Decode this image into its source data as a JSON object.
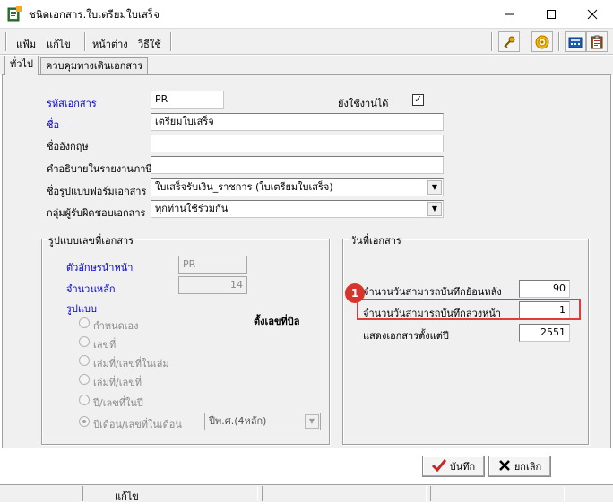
{
  "window": {
    "title": "ชนิดเอกสาร.ใบเตรียมใบเสร็จ",
    "icon": "app-document-icon",
    "controls": [
      "minimize",
      "maximize",
      "close"
    ]
  },
  "menu": {
    "items": [
      "แฟ้ม",
      "แก้ไข",
      "หน้าต่าง",
      "วิธีใช้"
    ],
    "toolbar_icons": [
      "key-icon",
      "target-icon",
      "calculator-icon",
      "clipboard-icon"
    ]
  },
  "tabs": [
    {
      "label": "ทั่วไป",
      "active": true
    },
    {
      "label": "ควบคุมทางเดินเอกสาร",
      "active": false
    }
  ],
  "form": {
    "doc_code": {
      "label": "รหัสเอกสาร",
      "value": "PR"
    },
    "active_label": "ยังใช้งานได้",
    "active_checked": "✓",
    "name": {
      "label": "ชื่อ",
      "value": "เตรียมใบเสร็จ"
    },
    "name_en": {
      "label": "ชื่ออังกฤษ",
      "value": ""
    },
    "tax_report_desc": {
      "label": "คำอธิบายในรายงานภาษี",
      "value": ""
    },
    "form_name": {
      "label": "ชื่อรูปแบบฟอร์มเอกสาร",
      "value": "ใบเสร็จรับเงิน_ราชการ (ใบเตรียมใบเสร็จ)"
    },
    "responsible_group": {
      "label": "กลุ่มผู้รับผิดชอบเอกสาร",
      "value": "ทุกท่านใช้ร่วมกัน"
    }
  },
  "numbering": {
    "title": "รูปแบบเลขที่เอกสาร",
    "prefix": {
      "label": "ตัวอักษรนำหน้า",
      "value": "PR"
    },
    "digits": {
      "label": "จำนวนหลัก",
      "value": "14"
    },
    "format_label": "รูปแบบ",
    "set_number_link": "ตั้งเลขที่บิล",
    "options": [
      {
        "label": "กำหนดเอง",
        "selected": false
      },
      {
        "label": "เลขที่",
        "selected": false
      },
      {
        "label": "เล่มที่/เลขที่ในเล่ม",
        "selected": false
      },
      {
        "label": "เล่มที่/เลขที่",
        "selected": false
      },
      {
        "label": "ปี/เลขที่ในปี",
        "selected": false
      },
      {
        "label": "ปีเดือน/เลขที่ในเดือน",
        "selected": true
      }
    ],
    "year_format": "ปีพ.ศ.(4หลัก)"
  },
  "doc_date": {
    "title": "วันที่เอกสาร",
    "backdate_days": {
      "label": "จำนวนวันสามารถบันทึกย้อนหลัง",
      "value": "90"
    },
    "forward_days": {
      "label": "จำนวนวันสามารถบันทึกล่วงหน้า",
      "value": "1"
    },
    "show_from_year": {
      "label": "แสดงเอกสารตั้งแต่ปี",
      "value": "2551"
    }
  },
  "annotation": {
    "number": "1",
    "color": "#e23b3b"
  },
  "buttons": {
    "save": "บันทึก",
    "cancel": "ยกเลิก"
  },
  "status": {
    "mode": "แก้ไข"
  }
}
